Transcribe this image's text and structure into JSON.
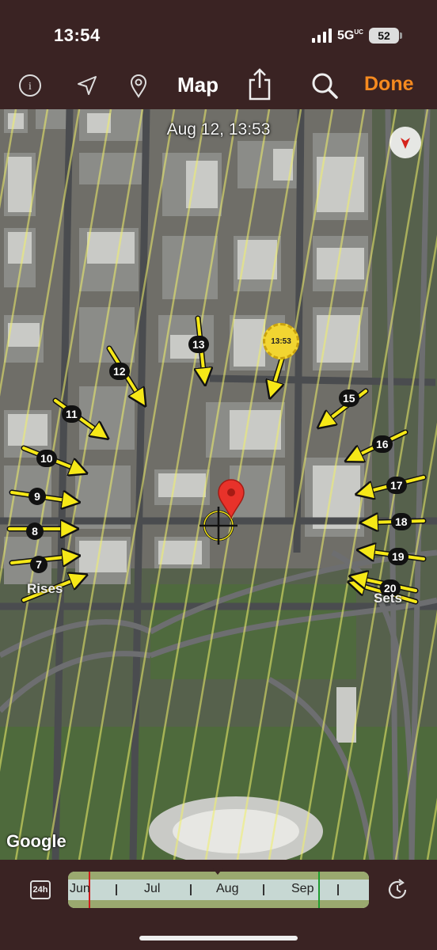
{
  "status": {
    "time": "13:54",
    "network": "5G",
    "network_sup": "UC",
    "battery": "52"
  },
  "toolbar": {
    "title": "Map",
    "done_label": "Done",
    "icons": [
      "info-icon",
      "location-arrow-icon",
      "pin-icon",
      "share-icon",
      "search-icon"
    ]
  },
  "map": {
    "datetime": "Aug 12, 13:53",
    "sun_badge": "13:53",
    "rises_label": "Rises",
    "sets_label": "Sets",
    "attribution": "Google",
    "markers": [
      "7",
      "8",
      "9",
      "10",
      "11",
      "12",
      "13",
      "15",
      "16",
      "17",
      "18",
      "19",
      "20"
    ]
  },
  "timeline": {
    "toggle_label": "24h",
    "months": [
      "Jun",
      "Jul",
      "Aug",
      "Sep"
    ]
  }
}
